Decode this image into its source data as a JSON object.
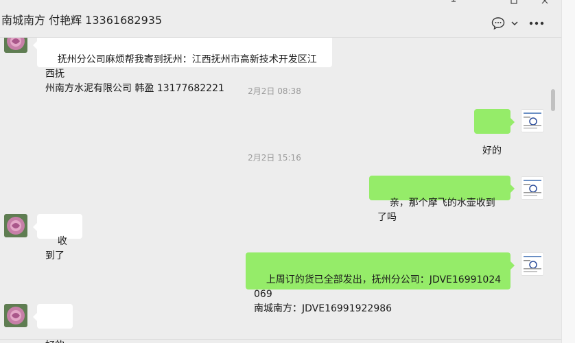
{
  "window": {
    "title": "南城南方 付艳辉 13361682935",
    "controls": [
      "pin-icon",
      "maximize-icon",
      "close-icon"
    ]
  },
  "header_actions": [
    "chat-bubble-icon",
    "chevron-down-icon",
    "more-icon"
  ],
  "colors": {
    "background": "#ededed",
    "outgoing_bubble": "#95ec69",
    "incoming_bubble": "#ffffff",
    "timestamp": "#9a9a9a"
  },
  "messages": [
    {
      "direction": "in",
      "text": "抚州分公司麻烦帮我寄到抚州：江西抚州市高新技术开发区江西抚\n州南方水泥有限公司 韩盈 13177682221"
    },
    {
      "timestamp": "2月2日 08:38"
    },
    {
      "direction": "out",
      "text": "好的"
    },
    {
      "timestamp": "2月2日 15:16"
    },
    {
      "direction": "out",
      "text": "亲，那个摩飞的水壶收到了吗"
    },
    {
      "direction": "in",
      "text": "收到了"
    },
    {
      "direction": "out",
      "text": "上周订的货已全部发出，抚州分公司：JDVE16991024069\n南城南方：JDVE16991922986"
    },
    {
      "direction": "in",
      "text": "好的"
    }
  ]
}
